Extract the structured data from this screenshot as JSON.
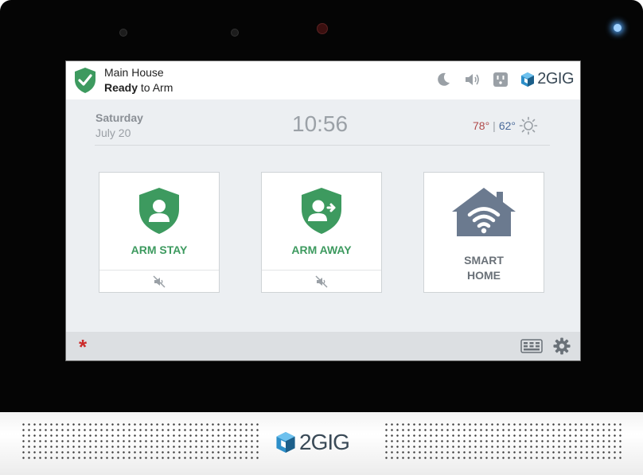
{
  "colors": {
    "accent_green": "#3d9a5f",
    "bezel": "#050505",
    "screen_bg": "#eceff2",
    "panic_red": "#cc2a2a",
    "temp_high": "#b04a4a",
    "temp_low": "#4a6a9a"
  },
  "status": {
    "shield_icon": "check-shield-icon",
    "location": "Main House",
    "ready_bold": "Ready",
    "ready_rest": " to Arm",
    "icons": [
      "moon-icon",
      "speaker-icon",
      "outlet-icon"
    ],
    "brand": "2GIG"
  },
  "datetime": {
    "day": "Saturday",
    "date": "July 20",
    "time": "10:56"
  },
  "weather": {
    "high": "78°",
    "separator": "|",
    "low": "62°",
    "icon": "sun-icon"
  },
  "tiles": [
    {
      "label": "ARM STAY",
      "icon": "shield-user-icon",
      "footer_icon": "mute-icon"
    },
    {
      "label": "ARM AWAY",
      "icon": "shield-user-leave-icon",
      "footer_icon": "mute-icon"
    },
    {
      "label_line1": "SMART",
      "label_line2": "HOME",
      "icon": "smart-home-wifi-icon"
    }
  ],
  "bottombar": {
    "panic": "*",
    "keypad_icon": "keypad-icon",
    "settings_icon": "gear-icon"
  },
  "device": {
    "brand": "2GIG"
  }
}
